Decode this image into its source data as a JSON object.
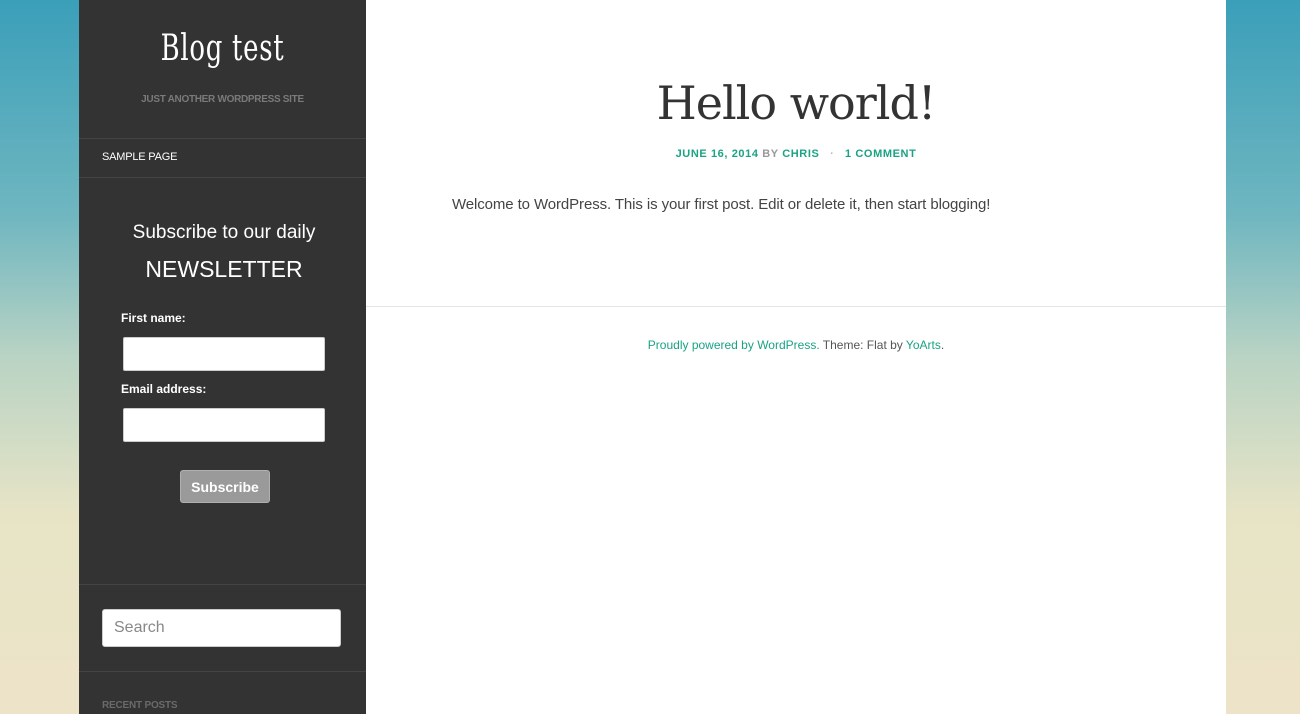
{
  "site": {
    "title": "Blog test",
    "description": "JUST ANOTHER WORDPRESS SITE"
  },
  "nav": {
    "items": [
      {
        "label": "SAMPLE PAGE"
      }
    ]
  },
  "newsletter": {
    "title_line1": "Subscribe to our daily",
    "title_line2": "NEWSLETTER",
    "first_name_label": "First name:",
    "first_name_value": "",
    "email_label": "Email address:",
    "email_value": "",
    "subscribe_label": "Subscribe"
  },
  "search": {
    "placeholder": "Search"
  },
  "recent_posts": {
    "heading": "RECENT POSTS"
  },
  "post": {
    "title": "Hello world!",
    "date": "JUNE 16, 2014",
    "by": "BY",
    "author": "CHRIS",
    "separator": "·",
    "comments": "1 COMMENT",
    "body": "Welcome to WordPress. This is your first post. Edit or delete it, then start blogging!"
  },
  "footer": {
    "powered_link": "Proudly powered by WordPress.",
    "theme_text": " Theme: Flat by ",
    "theme_author_link": "YoArts",
    "period": "."
  },
  "colors": {
    "accent": "#1aa384",
    "sidebar_bg": "#333333",
    "main_bg": "#ffffff"
  }
}
